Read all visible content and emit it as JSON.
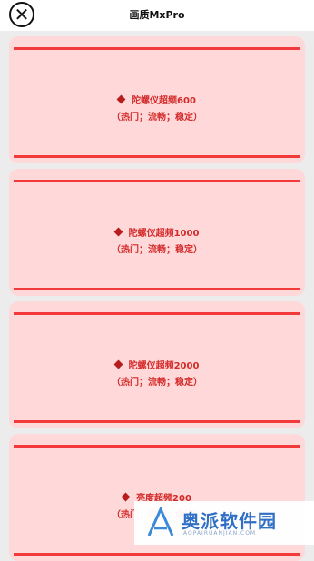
{
  "header": {
    "title": "画质MxPro"
  },
  "cards": [
    {
      "name": "陀螺仪超频600",
      "tags": "（热门；流畅；稳定）"
    },
    {
      "name": "陀螺仪超频1000",
      "tags": "（热门；流畅；稳定）"
    },
    {
      "name": "陀螺仪超频2000",
      "tags": "（热门；流畅；稳定）"
    },
    {
      "name": "亮度超频200",
      "tags": "（热门；流畅；稳定）"
    }
  ],
  "watermark": {
    "text": "奥派软件园",
    "url": "AOPAIRUANJIAN.COM"
  },
  "colors": {
    "card_bg": "#ffd9d9",
    "accent_line": "#f23a3a",
    "text_red": "#d42a2a"
  }
}
